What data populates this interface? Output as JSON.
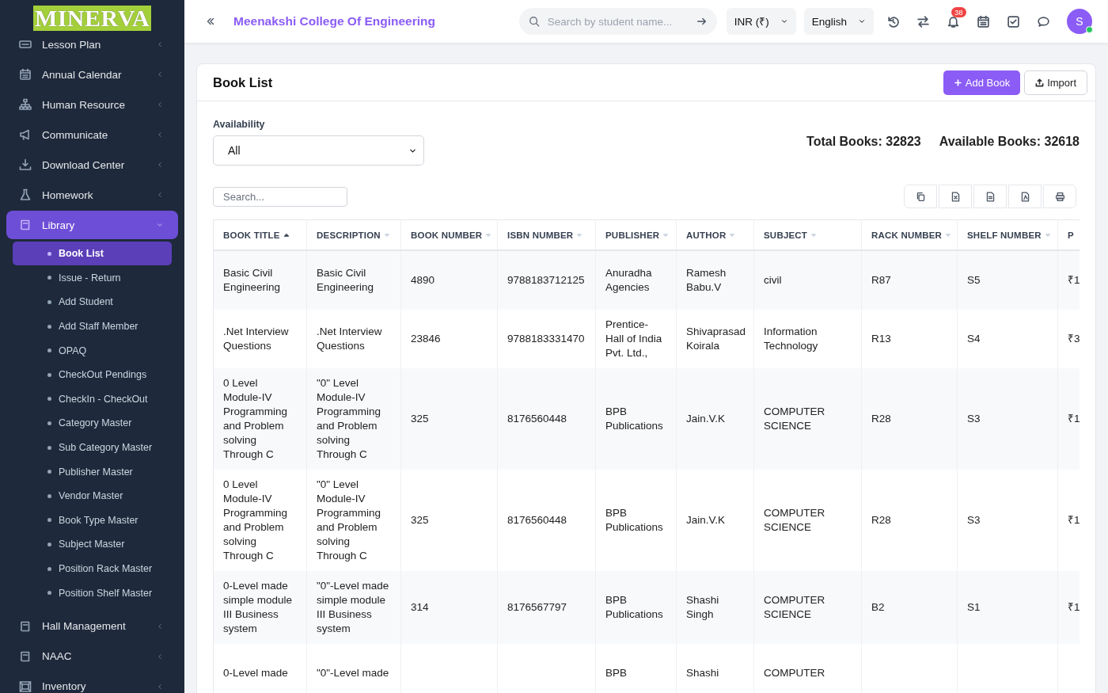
{
  "logo": "MINERVA",
  "sidebar": {
    "items": [
      {
        "label": "Lesson Plan",
        "selected": false,
        "expanded": false
      },
      {
        "label": "Annual Calendar",
        "selected": false,
        "expanded": false
      },
      {
        "label": "Human Resource",
        "selected": false,
        "expanded": false
      },
      {
        "label": "Communicate",
        "selected": false,
        "expanded": false
      },
      {
        "label": "Download Center",
        "selected": false,
        "expanded": false
      },
      {
        "label": "Homework",
        "selected": false,
        "expanded": false
      },
      {
        "label": "Library",
        "selected": true,
        "expanded": true,
        "children": [
          {
            "label": "Book List",
            "selected": true
          },
          {
            "label": "Issue - Return",
            "selected": false
          },
          {
            "label": "Add Student",
            "selected": false
          },
          {
            "label": "Add Staff Member",
            "selected": false
          },
          {
            "label": "OPAQ",
            "selected": false
          },
          {
            "label": "CheckOut Pendings",
            "selected": false
          },
          {
            "label": "CheckIn - CheckOut",
            "selected": false
          },
          {
            "label": "Category Master",
            "selected": false
          },
          {
            "label": "Sub Category Master",
            "selected": false
          },
          {
            "label": "Publisher Master",
            "selected": false
          },
          {
            "label": "Vendor Master",
            "selected": false
          },
          {
            "label": "Book Type Master",
            "selected": false
          },
          {
            "label": "Subject Master",
            "selected": false
          },
          {
            "label": "Position Rack Master",
            "selected": false
          },
          {
            "label": "Position Shelf Master",
            "selected": false
          }
        ]
      },
      {
        "label": "Hall Management",
        "selected": false,
        "expanded": false
      },
      {
        "label": "NAAC",
        "selected": false,
        "expanded": false
      },
      {
        "label": "Inventory",
        "selected": false,
        "expanded": false
      }
    ]
  },
  "header": {
    "college": "Meenakshi College Of Engineering",
    "search": {
      "placeholder": "Search by student name..."
    },
    "currency": "INR (₹)",
    "language": "English",
    "notifications": "38",
    "avatar": "S",
    "online": true
  },
  "card": {
    "title": "Book List",
    "buttons": [
      {
        "label": "Add Book",
        "kind": "primary"
      },
      {
        "label": "Import",
        "kind": "secondary"
      }
    ],
    "filter": {
      "label": "Availability",
      "value": "All"
    },
    "stats": [
      "Total Books: 32823",
      "Available Books: 32618"
    ],
    "search": {
      "placeholder": "Search..."
    },
    "table": {
      "columns": [
        {
          "label": "BOOK TITLE",
          "sorted": true
        },
        {
          "label": "DESCRIPTION",
          "sorted": false
        },
        {
          "label": "BOOK NUMBER",
          "sorted": false
        },
        {
          "label": "ISBN NUMBER",
          "sorted": false
        },
        {
          "label": "PUBLISHER",
          "sorted": false
        },
        {
          "label": "AUTHOR",
          "sorted": false
        },
        {
          "label": "SUBJECT",
          "sorted": false
        },
        {
          "label": "RACK NUMBER",
          "sorted": false
        },
        {
          "label": "SHELF NUMBER",
          "sorted": false
        },
        {
          "label": "P"
        }
      ],
      "rows": [
        [
          "Basic Civil Engineering",
          "Basic Civil Engineering",
          "4890",
          "9788183712125",
          "Anuradha Agencies",
          "Ramesh Babu.V",
          "civil",
          "R87",
          "S5",
          "₹1"
        ],
        [
          ".Net Interview Questions",
          ".Net Interview Questions",
          "23846",
          "9788183331470",
          "Prentice-Hall of India Pvt. Ltd.,",
          "Shivaprasad Koirala",
          "Information Technology",
          "R13",
          "S4",
          "₹3"
        ],
        [
          "0 Level Module-IV Programming and Problem solving Through C",
          "\"0\" Level Module-IV Programming and Problem solving Through C",
          "325",
          "8176560448",
          "BPB Publications",
          "Jain.V.K",
          "COMPUTER SCIENCE",
          "R28",
          "S3",
          "₹1"
        ],
        [
          "0 Level Module-IV Programming and Problem solving Through C",
          "\"0\" Level Module-IV Programming and Problem solving Through C",
          "325",
          "8176560448",
          "BPB Publications",
          "Jain.V.K",
          "COMPUTER SCIENCE",
          "R28",
          "S3",
          "₹1"
        ],
        [
          "0-Level made simple module III Business system",
          "\"0\"-Level made simple module III Business system",
          "314",
          "8176567797",
          "BPB Publications",
          "Shashi Singh",
          "COMPUTER SCIENCE",
          "B2",
          "S1",
          "₹1"
        ],
        [
          "0-Level made",
          "\"0\"-Level made",
          "",
          "",
          "BPB",
          "Shashi",
          "COMPUTER",
          "",
          "",
          ""
        ]
      ]
    }
  }
}
